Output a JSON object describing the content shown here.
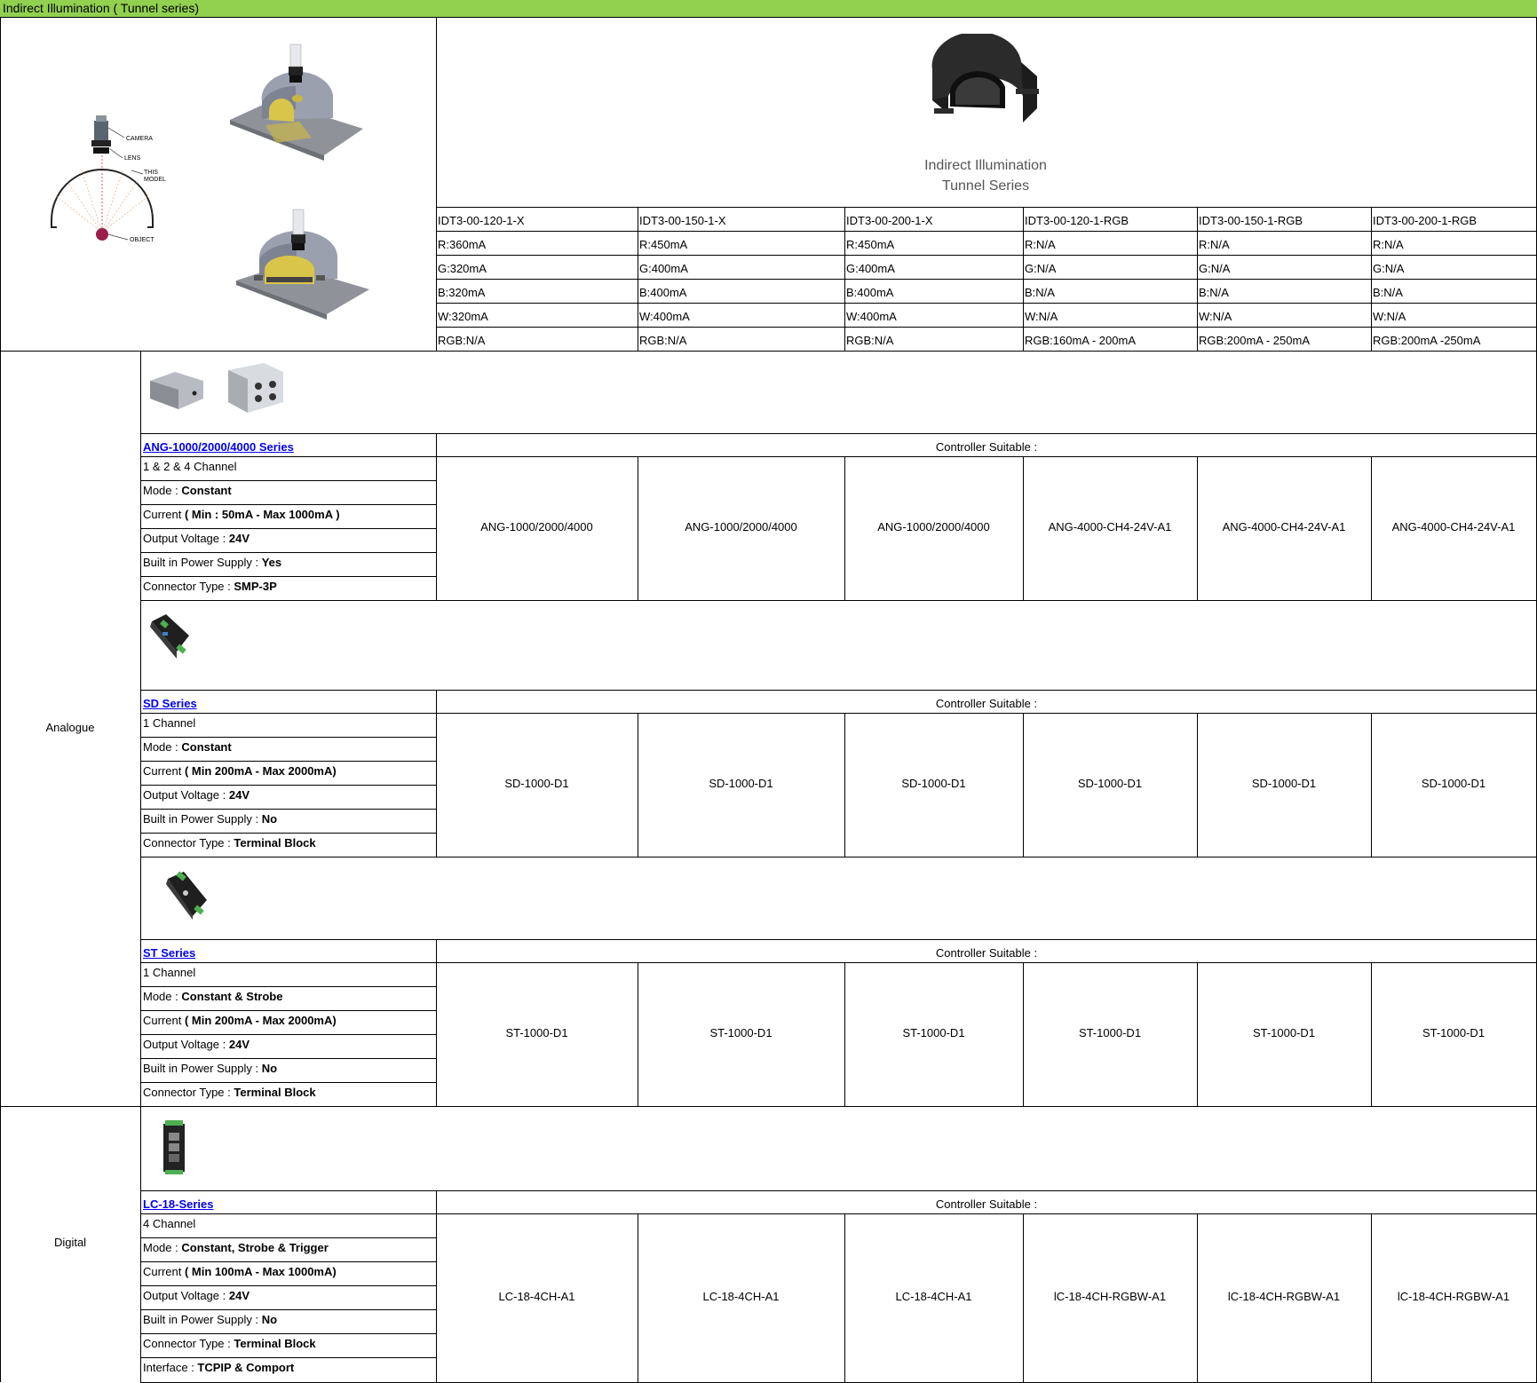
{
  "sheet_title": "Indirect Illumination ( Tunnel series)",
  "diagram": {
    "camera": "CAMERA",
    "lens": "LENS",
    "this_model": [
      "THIS",
      "MODEL"
    ],
    "object": "OBJECT"
  },
  "hero": {
    "line1": "Indirect Illumination",
    "line2": "Tunnel Series"
  },
  "models": [
    {
      "code": "IDT3-00-120-1-X",
      "r": "R:360mA",
      "g": "G:320mA",
      "b": "B:320mA",
      "w": "W:320mA",
      "rgb": "RGB:N/A"
    },
    {
      "code": "IDT3-00-150-1-X",
      "r": "R:450mA",
      "g": "G:400mA",
      "b": "B:400mA",
      "w": "W:400mA",
      "rgb": "RGB:N/A"
    },
    {
      "code": "IDT3-00-200-1-X",
      "r": "R:450mA",
      "g": "G:400mA",
      "b": "B:400mA",
      "w": "W:400mA",
      "rgb": "RGB:N/A"
    },
    {
      "code": "IDT3-00-120-1-RGB",
      "r": "R:N/A",
      "g": "G:N/A",
      "b": "B:N/A",
      "w": "W:N/A",
      "rgb": "RGB:160mA - 200mA"
    },
    {
      "code": "IDT3-00-150-1-RGB",
      "r": "R:N/A",
      "g": "G:N/A",
      "b": "B:N/A",
      "w": "W:N/A",
      "rgb": "RGB:200mA - 250mA"
    },
    {
      "code": "IDT3-00-200-1-RGB",
      "r": "R:N/A",
      "g": "G:N/A",
      "b": "B:N/A",
      "w": "W:N/A",
      "rgb": "RGB:200mA -250mA"
    }
  ],
  "groups": {
    "analogue": "Analogue",
    "digital": "Digital"
  },
  "controller_suitable": "Controller Suitable :",
  "series": [
    {
      "name": "ANG-1000/2000/4000 Series",
      "specs": [
        {
          "label": "1 &amp; 2 &amp; 4 Channel",
          "value": ""
        },
        {
          "label": "Mode : ",
          "value": "Constant"
        },
        {
          "label": "Current ",
          "value": "( Min : 50mA - Max 1000mA    )"
        },
        {
          "label": "Output Voltage : ",
          "value": "24V"
        },
        {
          "label": "Built in Power Supply : ",
          "value": "Yes"
        },
        {
          "label": "Connector Type : ",
          "value": "SMP-3P"
        }
      ],
      "controllers": [
        "ANG-1000/2000/4000",
        "ANG-1000/2000/4000",
        "ANG-1000/2000/4000",
        "ANG-4000-CH4-24V-A1",
        "ANG-4000-CH4-24V-A1",
        "ANG-4000-CH4-24V-A1"
      ]
    },
    {
      "name": "SD Series",
      "specs": [
        {
          "label": "1  Channel",
          "value": ""
        },
        {
          "label": "Mode : ",
          "value": "Constant"
        },
        {
          "label": "Current ",
          "value": "( Min 200mA - Max 2000mA)"
        },
        {
          "label": "Output Voltage : ",
          "value": "24V"
        },
        {
          "label": "Built in Power Supply : ",
          "value": "No"
        },
        {
          "label": "Connector Type : ",
          "value": "Terminal Block"
        }
      ],
      "controllers": [
        "SD-1000-D1",
        "SD-1000-D1",
        "SD-1000-D1",
        "SD-1000-D1",
        "SD-1000-D1",
        "SD-1000-D1"
      ]
    },
    {
      "name": "ST Series",
      "specs": [
        {
          "label": "1  Channel",
          "value": ""
        },
        {
          "label": "Mode : ",
          "value": "Constant &amp; Strobe"
        },
        {
          "label": "Current ",
          "value": "( Min 200mA - Max 2000mA)"
        },
        {
          "label": "Output Voltage : ",
          "value": "24V"
        },
        {
          "label": "Built in Power Supply : ",
          "value": "No"
        },
        {
          "label": "Connector Type : ",
          "value": "Terminal Block"
        }
      ],
      "controllers": [
        "ST-1000-D1",
        "ST-1000-D1",
        "ST-1000-D1",
        "ST-1000-D1",
        "ST-1000-D1",
        "ST-1000-D1"
      ]
    },
    {
      "name": "LC-18-Series",
      "specs": [
        {
          "label": "4  Channel",
          "value": ""
        },
        {
          "label": "Mode : ",
          "value": "Constant, Strobe &amp; Trigger"
        },
        {
          "label": "Current ",
          "value": "( Min 100mA - Max 1000mA)"
        },
        {
          "label": "Output Voltage : ",
          "value": "24V"
        },
        {
          "label": "Built in Power Supply : ",
          "value": "No"
        },
        {
          "label": "Connector Type : ",
          "value": "Terminal Block"
        },
        {
          "label": "Interface : ",
          "value": "TCPIP &amp; Comport"
        }
      ],
      "controllers": [
        "LC-18-4CH-A1",
        "LC-18-4CH-A1",
        "LC-18-4CH-A1",
        "lC-18-4CH-RGBW-A1",
        "lC-18-4CH-RGBW-A1",
        "lC-18-4CH-RGBW-A1"
      ]
    }
  ]
}
